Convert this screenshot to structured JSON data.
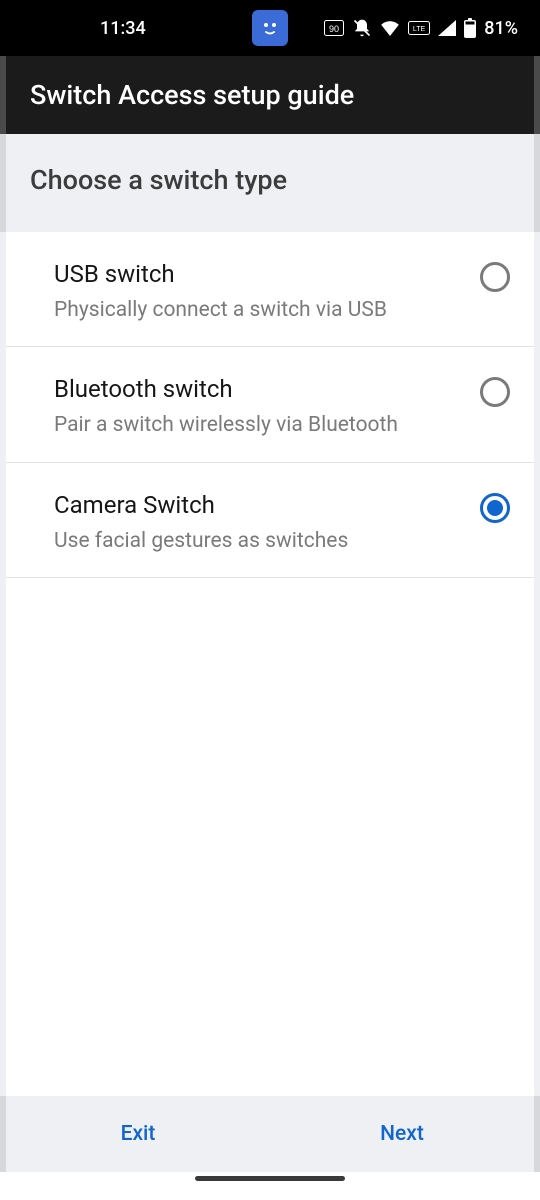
{
  "status": {
    "time": "11:34",
    "battery_percent": "81%"
  },
  "app_bar": {
    "title": "Switch Access setup guide"
  },
  "section": {
    "heading": "Choose a switch type"
  },
  "options": [
    {
      "title": "USB switch",
      "desc": "Physically connect a switch via USB",
      "selected": false
    },
    {
      "title": "Bluetooth switch",
      "desc": "Pair a switch wirelessly via Bluetooth",
      "selected": false
    },
    {
      "title": "Camera Switch",
      "desc": "Use facial gestures as switches",
      "selected": true
    }
  ],
  "buttons": {
    "exit": "Exit",
    "next": "Next"
  }
}
